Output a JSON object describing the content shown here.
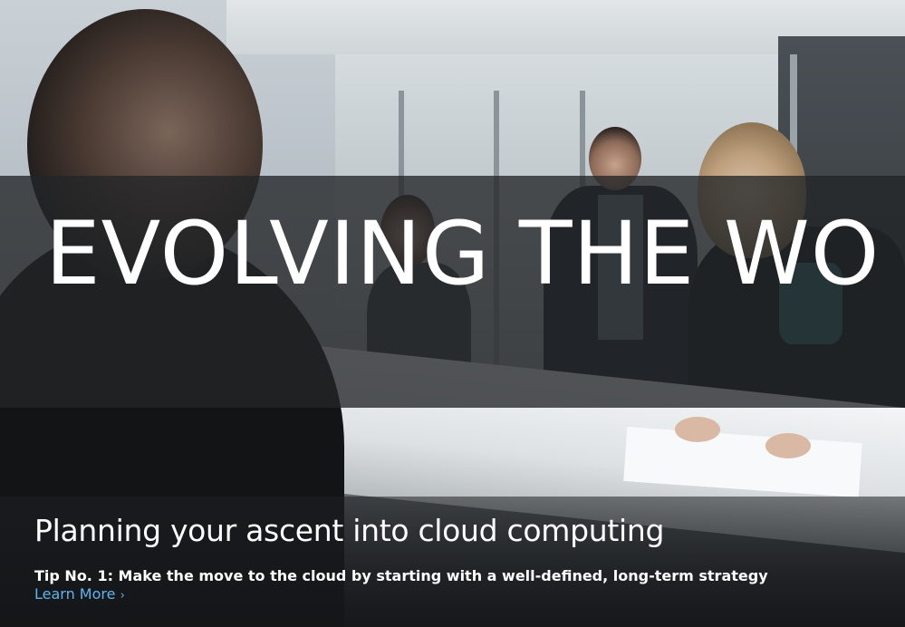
{
  "hero": {
    "title": "EVOLVING THE WO"
  },
  "promo": {
    "heading": "Planning your ascent into cloud computing",
    "description": "Tip No. 1: Make the move to the cloud by starting with a well-defined, long-term strategy",
    "link_label": "Learn More",
    "link_arrow": "›",
    "link_color": "#5fb3ef"
  }
}
